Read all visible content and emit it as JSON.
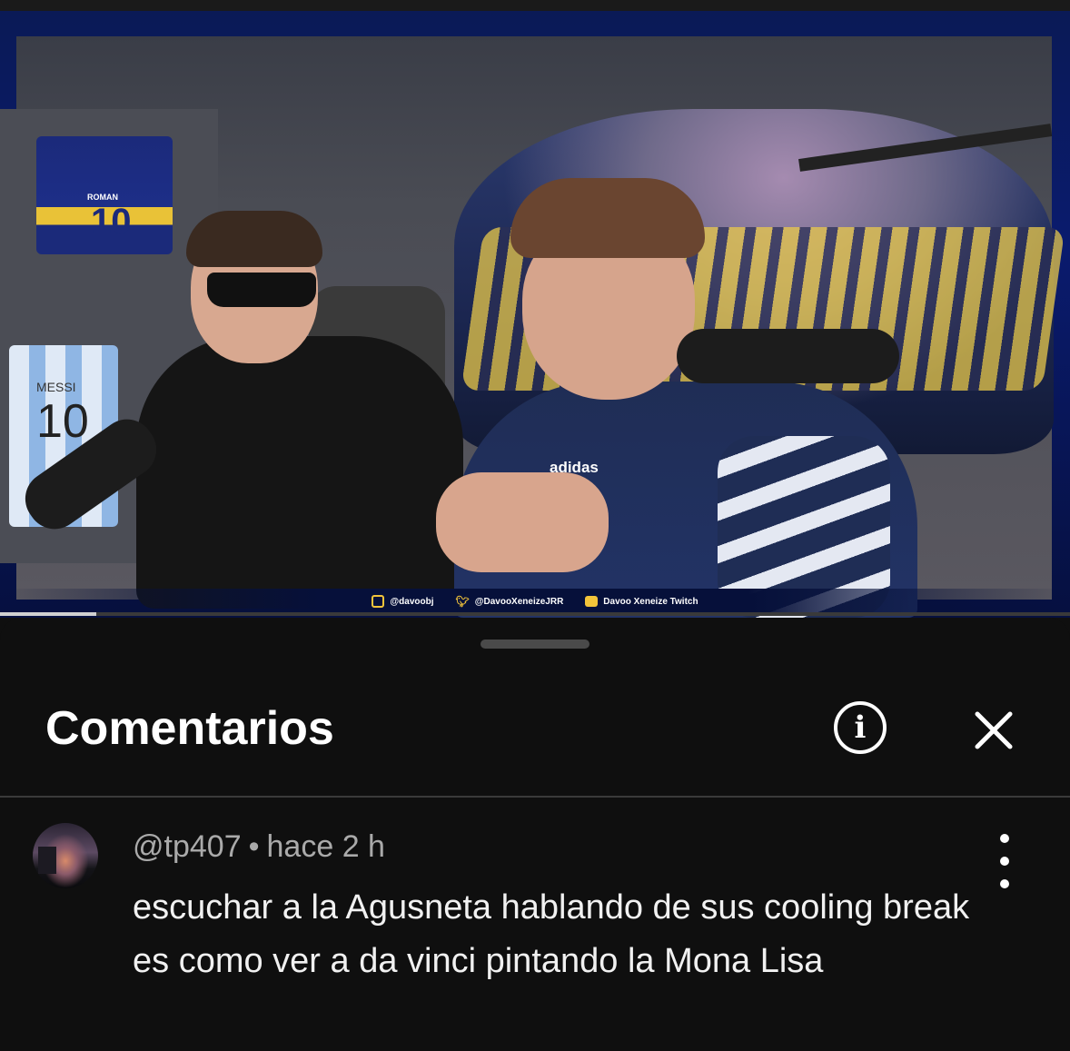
{
  "video": {
    "overlay": {
      "instagram": "@davoobj",
      "twitter": "@DavooXeneizeJRR",
      "twitch": "Davoo Xeneize Twitch"
    },
    "jersey_left_name": "ROMAN",
    "jersey_left_number": "10",
    "jersey_bottom_name": "MESSI",
    "jersey_bottom_number": "10",
    "progress_fraction": 0.09
  },
  "comments_sheet": {
    "title": "Comentarios",
    "icons": {
      "info": "info-icon",
      "close": "close-icon",
      "more": "more-vertical-icon"
    },
    "comments": [
      {
        "author": "@tp407",
        "separator": "•",
        "time": "hace 2 h",
        "text": "escuchar a la Agusneta hablando de sus cooling break es como ver a da vinci pintando la Mona Lisa"
      }
    ]
  }
}
